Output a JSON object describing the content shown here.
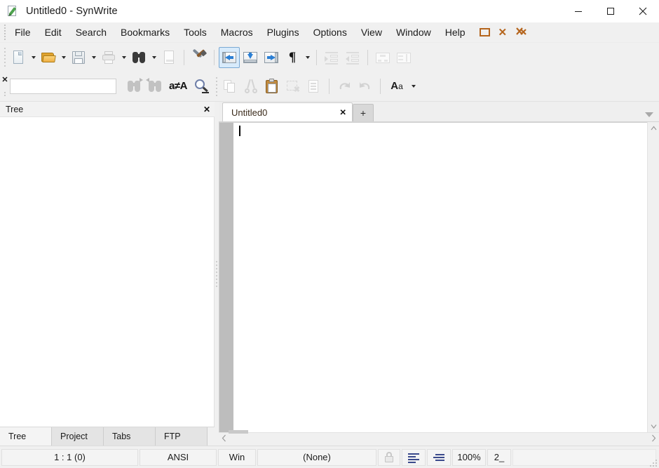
{
  "window": {
    "title": "Untitled0 - SynWrite",
    "app_icon": "document-pencil-icon",
    "minimize_label": "−",
    "maximize_label": "☐",
    "close_label": "✕"
  },
  "menubar": {
    "items": [
      {
        "label": "File"
      },
      {
        "label": "Edit"
      },
      {
        "label": "Search"
      },
      {
        "label": "Bookmarks"
      },
      {
        "label": "Tools"
      },
      {
        "label": "Macros"
      },
      {
        "label": "Plugins"
      },
      {
        "label": "Options"
      },
      {
        "label": "View"
      },
      {
        "label": "Window"
      },
      {
        "label": "Help"
      }
    ],
    "mdi": {
      "restore_name": "mdi-restore-icon",
      "close_name": "mdi-close-icon",
      "close_all_name": "mdi-close-all-icon",
      "close_label": "✕",
      "close_all_label": "✕"
    },
    "accent_color": "#b5651d"
  },
  "toolbar_main": {
    "buttons": [
      {
        "name": "new-file-button",
        "icon": "new-document-icon",
        "dropdown": true,
        "enabled": true
      },
      {
        "name": "open-file-button",
        "icon": "open-folder-icon",
        "dropdown": true,
        "enabled": true
      },
      {
        "name": "save-file-button",
        "icon": "save-floppy-icon",
        "dropdown": true,
        "enabled": true
      },
      {
        "name": "print-button",
        "icon": "printer-icon",
        "dropdown": true,
        "enabled": false
      },
      {
        "name": "find-button",
        "icon": "binoculars-icon",
        "dropdown": true,
        "enabled": true
      },
      {
        "name": "page-setup-button",
        "icon": "page-icon",
        "dropdown": false,
        "enabled": false
      },
      {
        "name": "tools-button",
        "icon": "wrench-hammer-icon",
        "dropdown": false,
        "enabled": true
      },
      {
        "name": "toggle-left-panel-button",
        "icon": "panel-left-arrow-icon",
        "dropdown": false,
        "enabled": true,
        "active": true
      },
      {
        "name": "toggle-bottom-panel-button",
        "icon": "panel-down-arrow-icon",
        "dropdown": false,
        "enabled": true
      },
      {
        "name": "toggle-right-panel-button",
        "icon": "panel-right-arrow-icon",
        "dropdown": false,
        "enabled": true
      },
      {
        "name": "show-nonprinting-button",
        "icon": "pilcrow-icon",
        "dropdown": true,
        "enabled": true,
        "glyph": "¶"
      },
      {
        "name": "indent-button",
        "icon": "indent-right-icon",
        "dropdown": false,
        "enabled": false
      },
      {
        "name": "outdent-button",
        "icon": "indent-left-icon",
        "dropdown": false,
        "enabled": false
      },
      {
        "name": "group-button",
        "icon": "group-box-icon",
        "dropdown": false,
        "enabled": false
      },
      {
        "name": "split-button",
        "icon": "split-box-icon",
        "dropdown": false,
        "enabled": false
      }
    ],
    "active_highlight_color": "#d8ebfb",
    "active_border_color": "#7aa9d4"
  },
  "toolbar_search": {
    "close_label": "✕",
    "input_value": "",
    "input_placeholder": "",
    "buttons": [
      {
        "name": "find-next-button",
        "icon": "binoculars-next-icon",
        "enabled": false
      },
      {
        "name": "find-previous-button",
        "icon": "binoculars-previous-icon",
        "enabled": false
      },
      {
        "name": "match-case-button",
        "icon": "case-sensitive-icon",
        "label": "a≠A",
        "enabled": true
      },
      {
        "name": "find-options-button",
        "icon": "magnifier-icon",
        "enabled": true
      }
    ],
    "edit_buttons": [
      {
        "name": "copy-button",
        "icon": "copy-icon",
        "enabled": false
      },
      {
        "name": "cut-button",
        "icon": "scissors-icon",
        "enabled": false
      },
      {
        "name": "paste-button",
        "icon": "clipboard-paste-icon",
        "enabled": true
      },
      {
        "name": "delete-button",
        "icon": "delete-icon",
        "enabled": false
      },
      {
        "name": "select-all-button",
        "icon": "select-all-icon",
        "enabled": false
      },
      {
        "name": "undo-button",
        "icon": "undo-arrow-icon",
        "enabled": false
      },
      {
        "name": "redo-button",
        "icon": "redo-arrow-icon",
        "enabled": false
      },
      {
        "name": "font-button",
        "icon": "font-size-icon",
        "label": "Aa",
        "enabled": true
      }
    ]
  },
  "tree_panel": {
    "header_title": "Tree",
    "close_label": "✕",
    "tabs": [
      {
        "label": "Tree",
        "active": true
      },
      {
        "label": "Project",
        "active": false
      },
      {
        "label": "Tabs",
        "active": false
      },
      {
        "label": "FTP",
        "active": false
      }
    ]
  },
  "editor": {
    "tabs": [
      {
        "label": "Untitled0",
        "active": true,
        "close_label": "✕"
      }
    ],
    "add_tab_label": "+",
    "tab_list_icon": "chevron-down-icon",
    "content": "",
    "scroll_up_label": "⌃",
    "scroll_down_label": "⌄",
    "scroll_left_label": "‹",
    "scroll_right_label": "›"
  },
  "statusbar": {
    "caret_position": "1 : 1 (0)",
    "encoding": "ANSI",
    "line_ends": "Win",
    "syntax": "(None)",
    "lock_icon": "lock-icon",
    "wrap_icon": "word-wrap-icon",
    "align_icon": "text-align-icon",
    "zoom": "100%",
    "tab_mode": "2_",
    "message": "",
    "resize_grip": "resize-grip-icon"
  }
}
